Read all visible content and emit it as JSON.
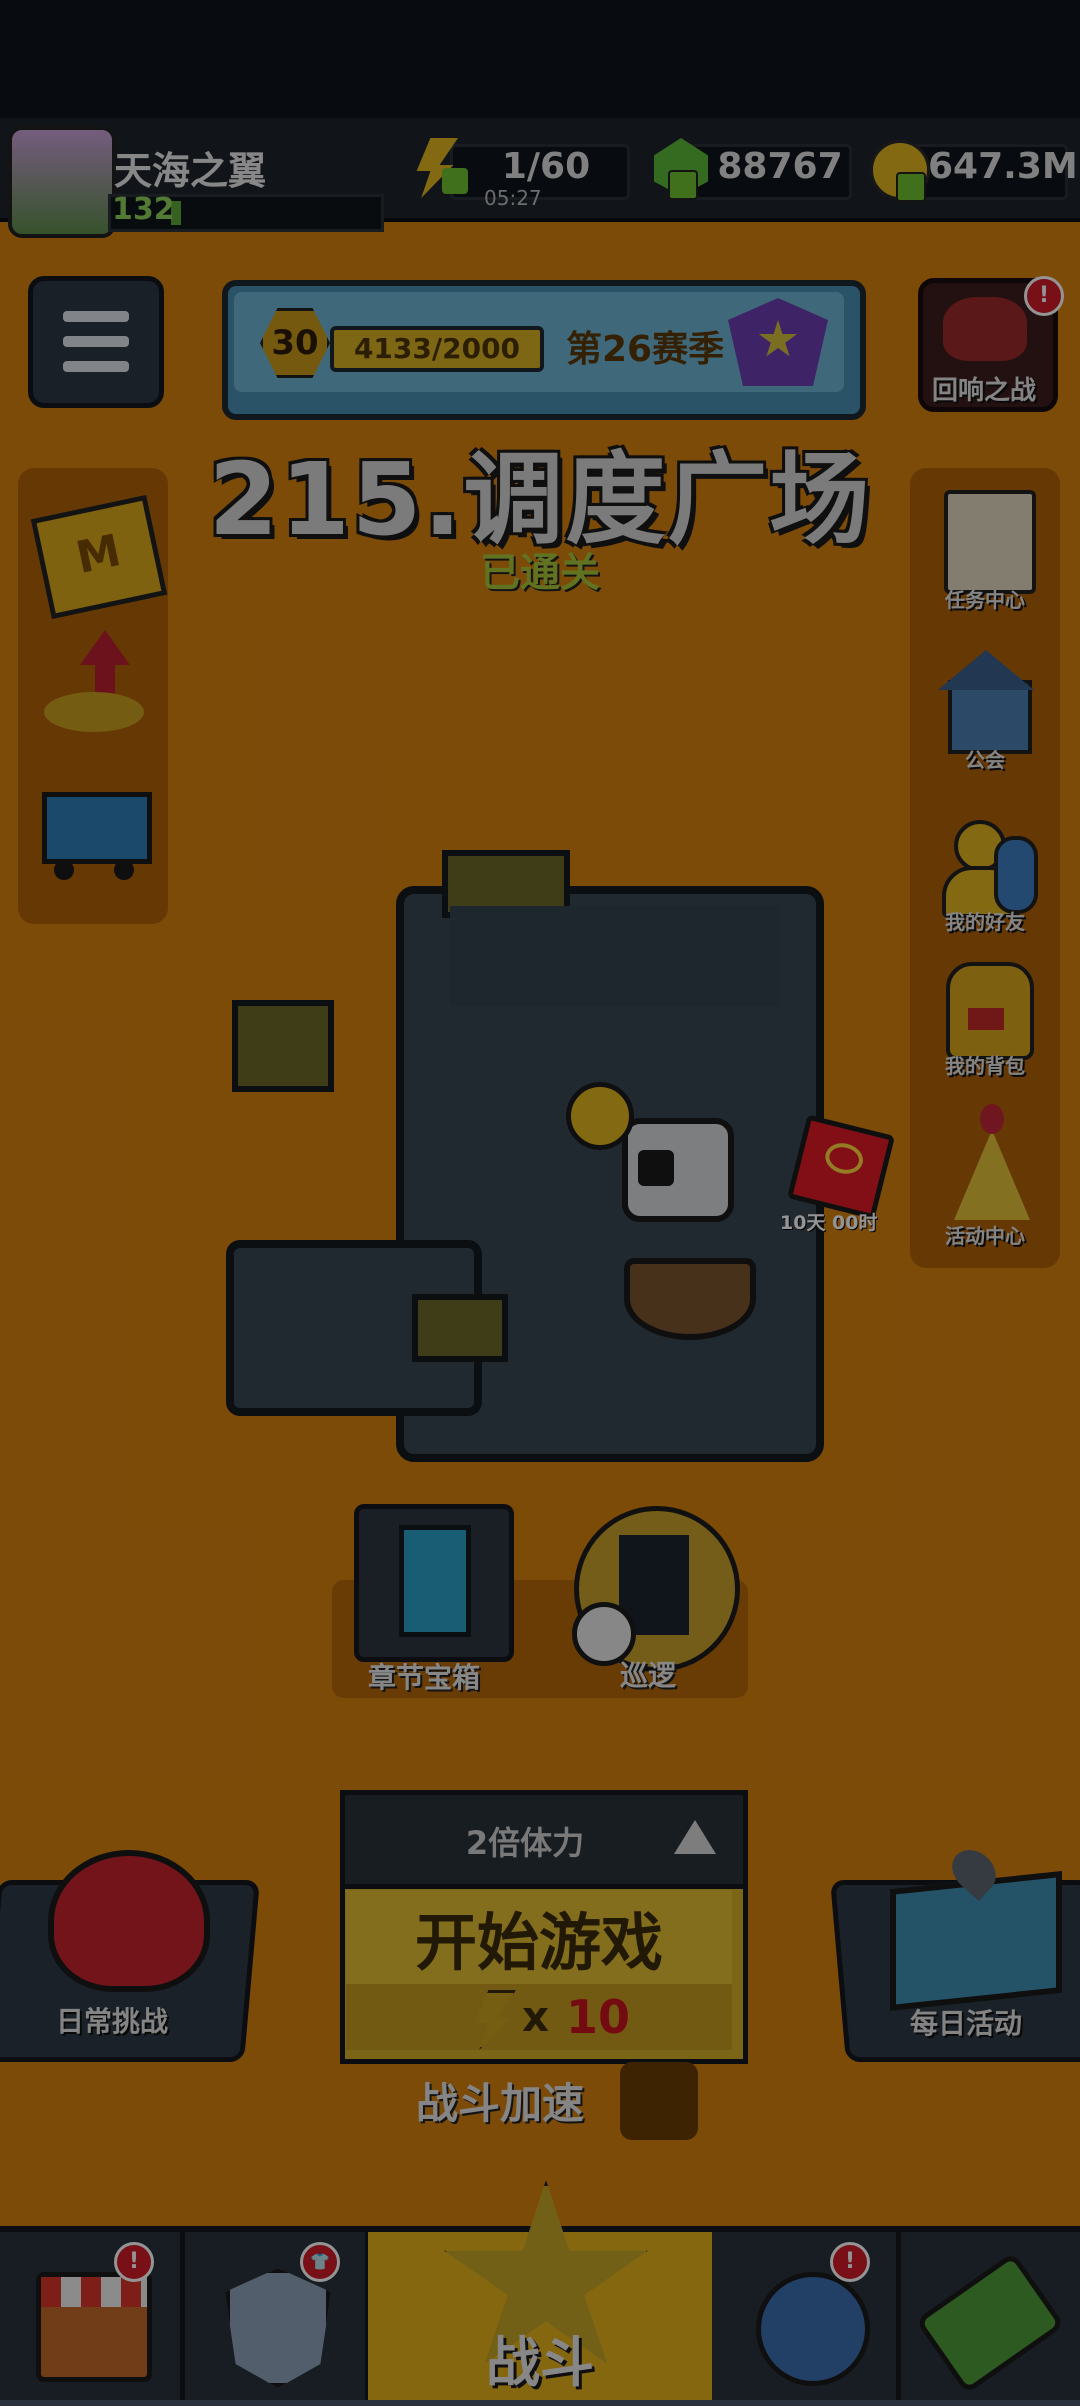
{
  "profile": {
    "name": "天海之翼",
    "level": "132"
  },
  "resources": {
    "energy": {
      "value": "1/60",
      "timer": "05:27"
    },
    "gems": "88767",
    "coins": "647.3M"
  },
  "season": {
    "level": "30",
    "progress": "4133/2000",
    "name": "第26赛季"
  },
  "echo_battle": {
    "label": "回响之战",
    "badge": "!"
  },
  "level": {
    "title": "215.调度广场",
    "status": "已通关"
  },
  "right_sidebar": {
    "tasks": "任务中心",
    "guild": "公会",
    "friends": "我的好友",
    "backpack": "我的背包",
    "activity": "活动中心"
  },
  "red_packet": {
    "timer": "10天 00时"
  },
  "chapter_chest": {
    "label": "章节宝箱"
  },
  "patrol": {
    "label": "巡逻"
  },
  "daily_challenge": {
    "label": "日常挑战"
  },
  "daily_event": {
    "label": "每日活动"
  },
  "start_panel": {
    "multiplier": "2倍体力",
    "start_label": "开始游戏",
    "cost_prefix": "x",
    "cost_value": "10"
  },
  "battle_speed": {
    "label": "战斗加速"
  },
  "bottom_nav": {
    "battle_label": "战斗",
    "shop_badge": "!",
    "equip_badge": "👕",
    "talent_badge": "!"
  },
  "colors": {
    "background": "#d8810f",
    "accent_yellow": "#e3b219",
    "cost_red": "#c8141e",
    "cleared_green": "#a8c63a"
  }
}
